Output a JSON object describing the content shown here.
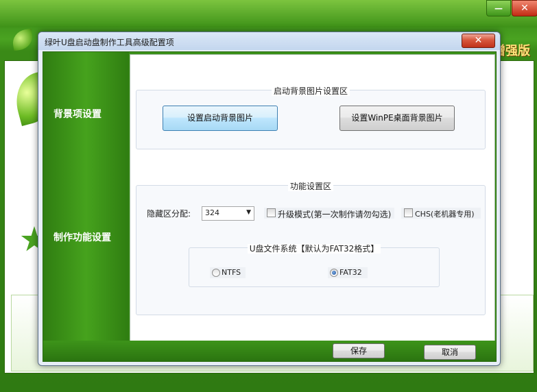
{
  "background_app": {
    "edition_label": "增强版",
    "minimize_glyph": "—",
    "close_glyph": "✕"
  },
  "dialog": {
    "title": "绿叶U盘启动盘制作工具高级配置项",
    "close_glyph": "✕"
  },
  "sidebar": {
    "items": [
      {
        "label": "背景项设置"
      },
      {
        "label": "制作功能设置"
      }
    ]
  },
  "background_section": {
    "title": "启动背景图片设置区",
    "set_boot_bg_label": "设置启动背景图片",
    "set_winpe_bg_label": "设置WinPE桌面背景图片"
  },
  "function_section": {
    "title": "功能设置区",
    "hidden_partition_label": "隐藏区分配:",
    "hidden_partition_value": "324",
    "upgrade_mode_label": "升级模式(第一次制作请勿勾选)",
    "upgrade_mode_checked": false,
    "chs_label": "CHS(老机器专用)",
    "chs_checked": false,
    "filesystem": {
      "title": "U盘文件系统【默认为FAT32格式】",
      "options": [
        "NTFS",
        "FAT32"
      ],
      "selected": "FAT32"
    }
  },
  "footer": {
    "save_label": "保存",
    "cancel_label": "取消"
  },
  "colors": {
    "accent_green": "#3b9019",
    "close_red": "#c0321a",
    "focus_blue": "#3c7fb1"
  }
}
